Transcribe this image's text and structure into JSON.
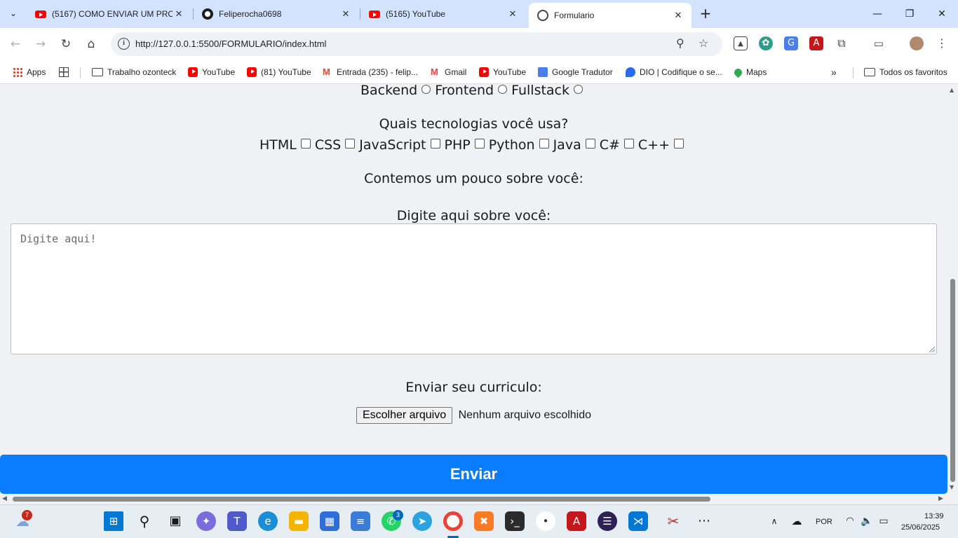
{
  "browser": {
    "tabs": [
      {
        "title": "(5167) COMO ENVIAR UM PRO",
        "favicon": "youtube-icon",
        "active": false
      },
      {
        "title": "Feliperocha0698",
        "favicon": "github-icon",
        "active": false
      },
      {
        "title": "(5165) YouTube",
        "favicon": "youtube-icon",
        "active": false
      },
      {
        "title": "Formulario",
        "favicon": "globe-icon",
        "active": true
      }
    ],
    "url": "http://127.0.0.1:5500/FORMULARIO/index.html",
    "bookmarks": [
      {
        "label": "Apps",
        "icon": "apps-icon"
      },
      {
        "label": "",
        "icon": "grid-icon"
      },
      {
        "label": "Trabalho ozonteck",
        "icon": "folder-icon"
      },
      {
        "label": "YouTube",
        "icon": "youtube-icon"
      },
      {
        "label": "(81) YouTube",
        "icon": "youtube-icon"
      },
      {
        "label": "Entrada (235) - felip...",
        "icon": "gmail-icon"
      },
      {
        "label": "Gmail",
        "icon": "gmail-icon"
      },
      {
        "label": "YouTube",
        "icon": "youtube-icon"
      },
      {
        "label": "Google Tradutor",
        "icon": "translate-icon"
      },
      {
        "label": "DIO | Codifique o se...",
        "icon": "dio-icon"
      },
      {
        "label": "Maps",
        "icon": "maps-icon"
      }
    ],
    "all_bookmarks_label": "Todos os favoritos"
  },
  "form": {
    "roles": [
      "Backend",
      "Frontend",
      "Fullstack"
    ],
    "tech_question": "Quais tecnologias você usa?",
    "techs": [
      "HTML",
      "CSS",
      "JavaScript",
      "PHP",
      "Python",
      "Java",
      "C#",
      "C++"
    ],
    "about_heading": "Contemos um pouco sobre você:",
    "about_label": "Digite aqui sobre você:",
    "about_placeholder": "Digite aqui!",
    "cv_label": "Enviar seu curriculo:",
    "file_button": "Escolher arquivo",
    "file_status": "Nenhum arquivo escolhido",
    "submit_label": "Enviar"
  },
  "taskbar": {
    "weather_badge": "7",
    "whatsapp_badge": "3",
    "language": "POR",
    "time": "13:39",
    "date": "25/06/2025"
  },
  "colors": {
    "submit_bg": "#0a7cff",
    "tabstrip_bg": "#d3e3fd",
    "page_bg": "#f0f1f4"
  }
}
